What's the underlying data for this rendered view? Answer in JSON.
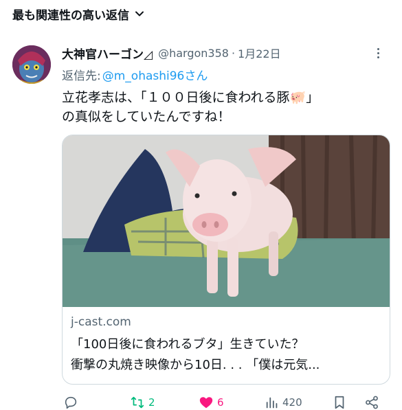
{
  "header": {
    "sort_label": "最も関連性の高い返信"
  },
  "tweet": {
    "display_name": "大神官ハーゴン◿",
    "handle": "@hargon358",
    "separator": "·",
    "date": "1月22日",
    "reply_prefix": "返信先:",
    "reply_mention": "@m_ohashi96さん",
    "text_line1": "立花孝志は、「１００日後に食われる豚🐖」",
    "text_line2": "の真似をしていたんですね！",
    "card": {
      "domain": "j-cast.com",
      "title_line1": "「100日後に食われるブタ」生きていた？",
      "title_line2": "衝撃の丸焼き映像から10日. . . 「僕は元気..."
    },
    "actions": {
      "reply_count": "",
      "retweet_count": "2",
      "like_count": "6",
      "view_count": "420"
    }
  },
  "colors": {
    "text_primary": "#0f1419",
    "text_secondary": "#536471",
    "link": "#1d9bf0",
    "retweet": "#00ba7c",
    "like": "#f91880",
    "border": "#cfd9de"
  },
  "icons": [
    "chevron-down-icon",
    "more-icon",
    "reply-icon",
    "retweet-icon",
    "heart-icon",
    "views-icon",
    "bookmark-icon",
    "share-icon"
  ]
}
